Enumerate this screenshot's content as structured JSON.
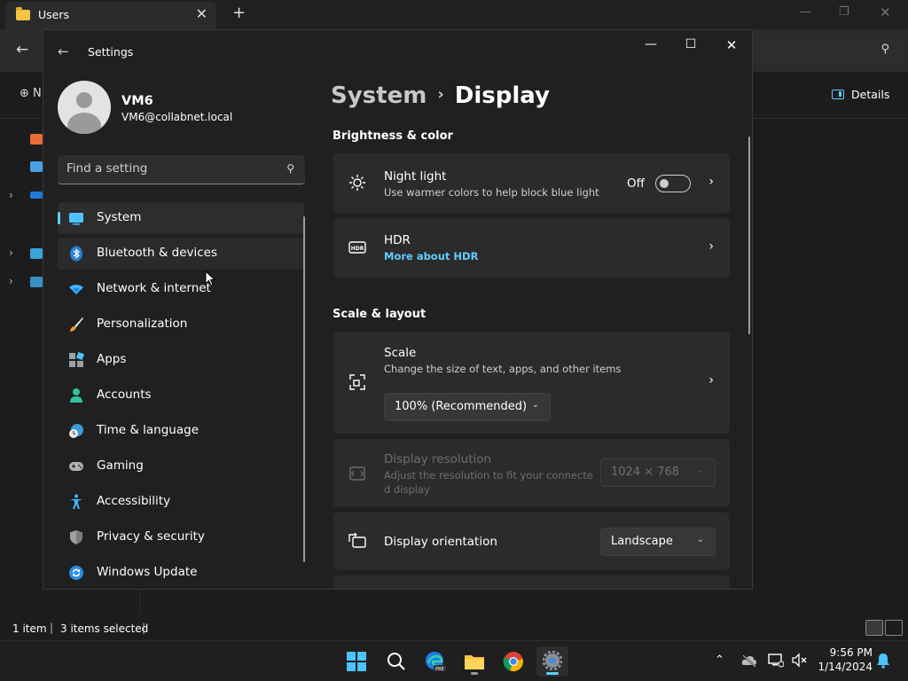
{
  "explorer": {
    "tab_title": "Users",
    "new_item_label": "N",
    "details_label": "Details",
    "status_items": "1 item",
    "status_selected": "3 items selected"
  },
  "settings": {
    "window_title": "Settings",
    "profile": {
      "name": "VM6",
      "email": "VM6@collabnet.local"
    },
    "search_placeholder": "Find a setting",
    "nav": [
      {
        "label": "System",
        "icon": "system-icon"
      },
      {
        "label": "Bluetooth & devices",
        "icon": "bluetooth-icon"
      },
      {
        "label": "Network & internet",
        "icon": "wifi-icon"
      },
      {
        "label": "Personalization",
        "icon": "brush-icon"
      },
      {
        "label": "Apps",
        "icon": "apps-icon"
      },
      {
        "label": "Accounts",
        "icon": "accounts-icon"
      },
      {
        "label": "Time & language",
        "icon": "globe-clock-icon"
      },
      {
        "label": "Gaming",
        "icon": "gamepad-icon"
      },
      {
        "label": "Accessibility",
        "icon": "accessibility-icon"
      },
      {
        "label": "Privacy & security",
        "icon": "shield-icon"
      },
      {
        "label": "Windows Update",
        "icon": "update-icon"
      }
    ],
    "breadcrumb": {
      "parent": "System",
      "current": "Display"
    },
    "sections": {
      "brightness": "Brightness & color",
      "scale_layout": "Scale & layout"
    },
    "night_light": {
      "title": "Night light",
      "subtitle": "Use warmer colors to help block blue light",
      "state": "Off"
    },
    "hdr": {
      "title": "HDR",
      "link": "More about HDR"
    },
    "scale": {
      "title": "Scale",
      "subtitle": "Change the size of text, apps, and other items",
      "value": "100% (Recommended)"
    },
    "resolution": {
      "title": "Display resolution",
      "subtitle_line1": "Adjust the resolution to fit your connecte",
      "subtitle_line2": "d display",
      "value": "1024 × 768"
    },
    "orientation": {
      "title": "Display orientation",
      "value": "Landscape"
    }
  },
  "taskbar": {
    "time": "9:56 PM",
    "date": "1/14/2024"
  },
  "colors": {
    "accent": "#60cdff",
    "window_bg": "#202020",
    "card_bg": "#2b2b2b"
  }
}
